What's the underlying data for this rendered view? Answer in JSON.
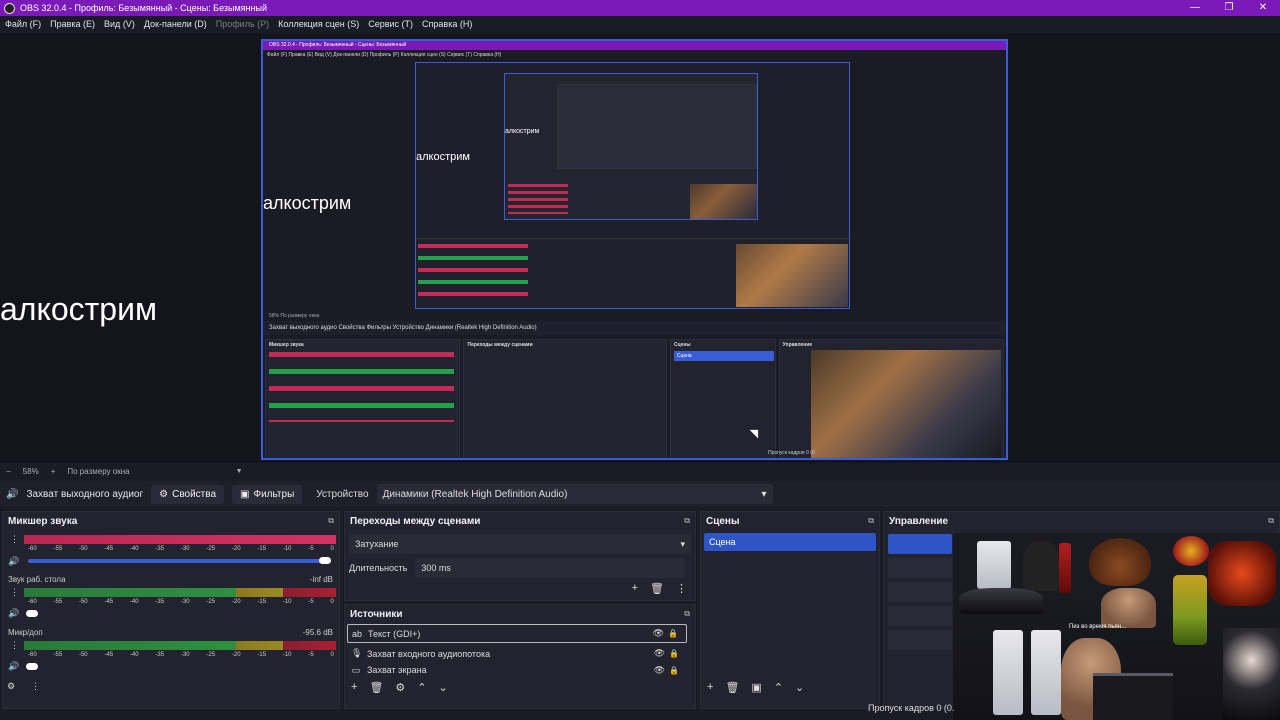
{
  "window": {
    "title": "OBS 32.0.4 - Профиль: Безымянный - Сцены: Безымянный",
    "controls": [
      "—",
      "❐",
      "✕"
    ]
  },
  "menu": [
    {
      "label": "Файл (F)"
    },
    {
      "label": "Правка (E)"
    },
    {
      "label": "Вид (V)"
    },
    {
      "label": "Док-панели (D)"
    },
    {
      "label": "Профиль (P)"
    },
    {
      "label": "Коллекция сцен (S)"
    },
    {
      "label": "Сервис (T)"
    },
    {
      "label": "Справка (H)"
    }
  ],
  "preview": {
    "overlay_text": "алкострим",
    "nested_title": "OBS 32.0.4 - Профиль: Безымянный - Сцены: Безымянный",
    "nested_menu": "Файл (F)   Правка (E)   Вид (V)   Док-панели (D)   Профиль (P)   Коллекция сцен (S)   Сервис (T)   Справка (H)",
    "nested_zoom": "58%   По размеру окна",
    "nested_toolbar": "Захват выходного аудио   Свойства   Фильтры   Устройство   Динамики (Realtek High Definition Audio)",
    "nested_skip": "Пропуск кадров 0 (0.",
    "nested_dock_titles": [
      "Микшер звука",
      "Переходы между сценами",
      "Сцены",
      "Управление"
    ],
    "nested_scene": "Сцена"
  },
  "zoom": {
    "minus": "−",
    "value": "58%",
    "plus": "+",
    "fit": "По размеру окна",
    "caret": "▼"
  },
  "toolbar": {
    "source_name": "Захват выходного аудиог",
    "properties": "Свойства",
    "filters": "Фильтры",
    "device_label": "Устройство",
    "device_value": "Динамики (Realtek High Definition Audio)"
  },
  "mixer": {
    "title": "Микшер звука",
    "scale": [
      "-60",
      "-55",
      "-50",
      "-45",
      "-40",
      "-35",
      "-30",
      "-25",
      "-20",
      "-15",
      "-10",
      "-5",
      "0"
    ],
    "channels": [
      {
        "name": "",
        "db": ""
      },
      {
        "name": "Звук раб. стола",
        "db": "-inf dB"
      },
      {
        "name": "Микр/доп",
        "db": "-95.6 dB"
      }
    ]
  },
  "transitions": {
    "title": "Переходы между сценами",
    "selected": "Затухание",
    "duration_label": "Длительность",
    "duration_value": "300 ms"
  },
  "sources": {
    "title": "Источники",
    "items": [
      {
        "name": "Текст (GDI+)",
        "icon": "text-icon"
      },
      {
        "name": "Захват входного аудиопотока",
        "icon": "microphone-icon"
      },
      {
        "name": "Захват экрана",
        "icon": "monitor-icon"
      }
    ]
  },
  "scenes": {
    "title": "Сцены",
    "items": [
      "Сцена"
    ]
  },
  "controls": {
    "title": "Управление"
  },
  "webcam": {
    "caption": "Пиз во время пьян..."
  },
  "status": {
    "dropped_frames": "Пропуск кадров 0 (0."
  },
  "colors": {
    "titlebar": "#7a1ab8",
    "accent": "#2e54c8",
    "background": "#1a1b24",
    "meter_red": "#c02c56",
    "meter_green": "#2f8f40"
  }
}
